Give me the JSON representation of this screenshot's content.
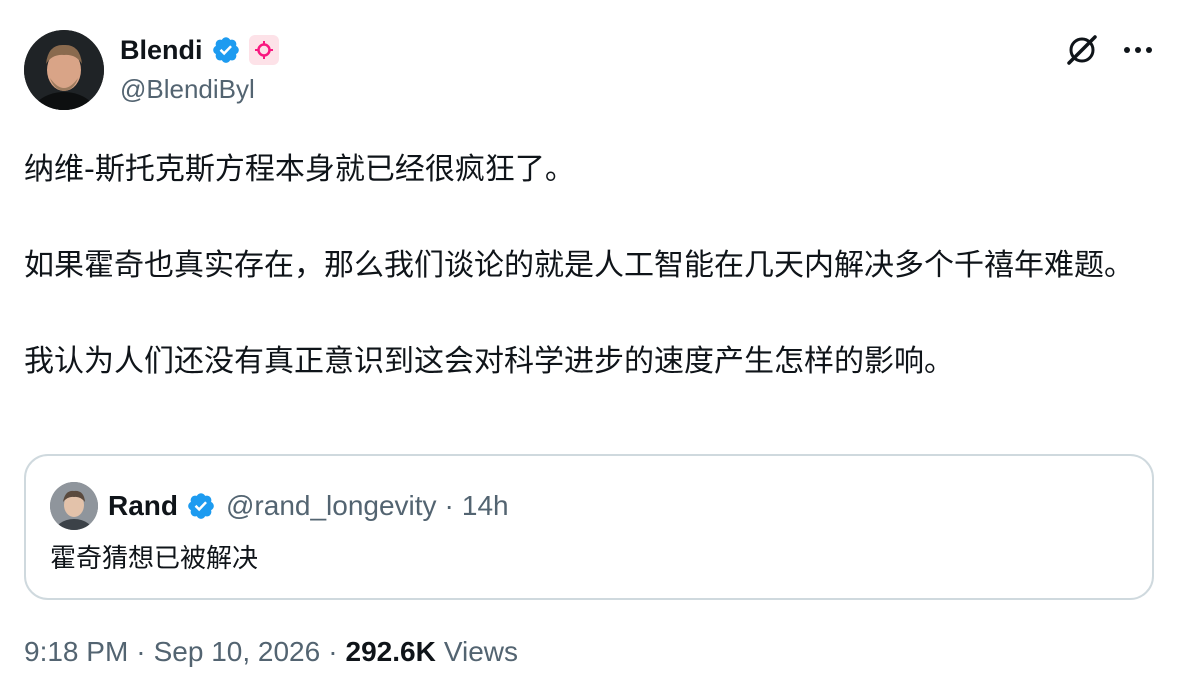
{
  "author": {
    "name": "Blendi",
    "handle": "@BlendiByl"
  },
  "tweet": {
    "paragraphs": [
      "纳维-斯托克斯方程本身就已经很疯狂了。",
      "如果霍奇也真实存在，那么我们谈论的就是人工智能在几天内解决多个千禧年难题。",
      "我认为人们还没有真正意识到这会对科学进步的速度产生怎样的影响。"
    ]
  },
  "quoted": {
    "name": "Rand",
    "handle": "@rand_longevity",
    "separator": "·",
    "time": "14h",
    "text": "霍奇猜想已被解决"
  },
  "footer": {
    "time": "9:18 PM",
    "dot1": "·",
    "date": "Sep 10, 2026",
    "dot2": "·",
    "views_count": "292.6K",
    "views_label": "Views"
  },
  "colors": {
    "verified_blue": "#1d9bf0",
    "secondary_text": "#536471",
    "affiliate_pink": "#f91880"
  },
  "icons": {
    "verified": "verified-badge-icon",
    "affiliate": "affiliate-badge-icon",
    "grok": "grok-icon",
    "more": "more-icon"
  }
}
